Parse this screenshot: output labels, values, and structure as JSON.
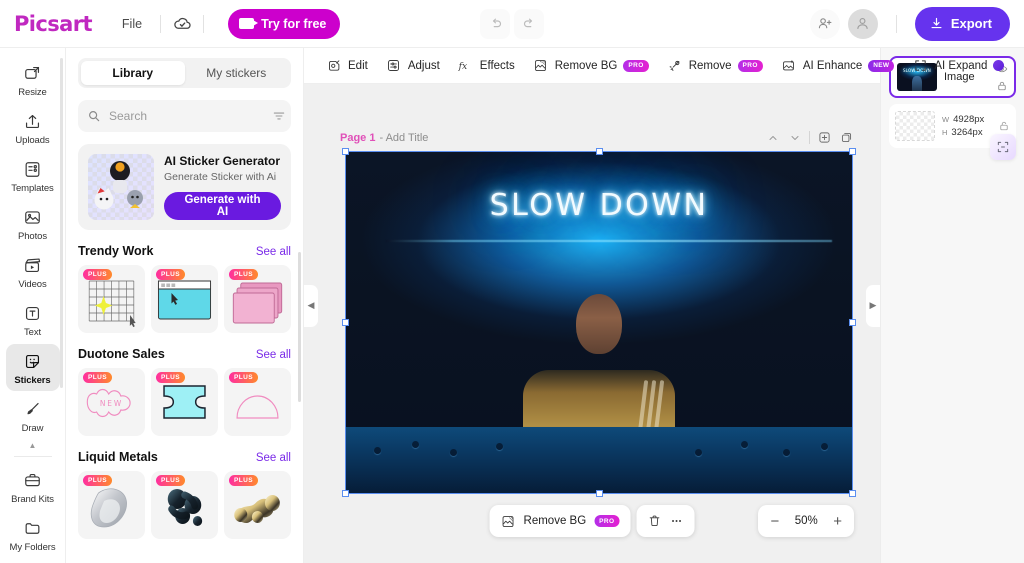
{
  "header": {
    "brand": "Picsart",
    "file_label": "File",
    "cloud_icon": "cloud-check-icon",
    "try_label": "Try for free",
    "undo_icon": "undo-icon",
    "redo_icon": "redo-icon",
    "invite_icon": "add-user-icon",
    "avatar_icon": "user-avatar-icon",
    "export_label": "Export",
    "export_icon": "download-icon",
    "export_color": "#6633ee",
    "try_color": "#cc00cc"
  },
  "rail": {
    "items": [
      {
        "label": "Resize",
        "icon": "resize-icon",
        "active": false
      },
      {
        "label": "Uploads",
        "icon": "upload-icon",
        "active": false
      },
      {
        "label": "Templates",
        "icon": "templates-icon",
        "active": false
      },
      {
        "label": "Photos",
        "icon": "photo-icon",
        "active": false
      },
      {
        "label": "Videos",
        "icon": "video-clapper-icon",
        "active": false
      },
      {
        "label": "Text",
        "icon": "text-icon",
        "active": false
      },
      {
        "label": "Stickers",
        "icon": "sticker-icon",
        "active": true
      },
      {
        "label": "Draw",
        "icon": "brush-icon",
        "active": false
      }
    ],
    "collapse_icon": "chevron-up-icon",
    "bottom_items": [
      {
        "label": "Brand Kits",
        "icon": "briefcase-icon"
      },
      {
        "label": "My Folders",
        "icon": "folder-icon"
      }
    ]
  },
  "panel": {
    "tabs": [
      {
        "label": "Library",
        "active": true
      },
      {
        "label": "My stickers",
        "active": false
      }
    ],
    "search": {
      "placeholder": "Search",
      "value": "",
      "icon": "search-icon",
      "filter_icon": "filter-icon"
    },
    "promo": {
      "title": "AI Sticker Generator",
      "subtitle": "Generate Sticker with Ai",
      "button": "Generate with AI",
      "button_color": "#6a1ae0"
    },
    "sections": [
      {
        "title": "Trendy Work",
        "see_all": "See all",
        "tiles": [
          {
            "badge": "PLUS",
            "art": "grid-sparkle"
          },
          {
            "badge": "PLUS",
            "art": "window-cyan"
          },
          {
            "badge": "PLUS",
            "art": "pink-stack"
          }
        ]
      },
      {
        "title": "Duotone Sales",
        "see_all": "See all",
        "tiles": [
          {
            "badge": "PLUS",
            "art": "new-blob"
          },
          {
            "badge": "PLUS",
            "art": "cyan-spool"
          },
          {
            "badge": "PLUS",
            "art": "pink-arch"
          }
        ]
      },
      {
        "title": "Liquid Metals",
        "see_all": "See all",
        "tiles": [
          {
            "badge": "PLUS",
            "art": "chrome-ring"
          },
          {
            "badge": "PLUS",
            "art": "black-splash"
          },
          {
            "badge": "PLUS",
            "art": "gold-chain"
          }
        ]
      }
    ]
  },
  "toolbar": {
    "items": [
      {
        "label": "Edit",
        "icon": "edit-image-icon",
        "badge": ""
      },
      {
        "label": "Adjust",
        "icon": "adjust-sliders-icon",
        "badge": ""
      },
      {
        "label": "Effects",
        "icon": "fx-icon",
        "badge": ""
      },
      {
        "label": "Remove BG",
        "icon": "remove-bg-icon",
        "badge": "PRO"
      },
      {
        "label": "Remove",
        "icon": "magic-eraser-icon",
        "badge": "PRO"
      },
      {
        "label": "AI Enhance",
        "icon": "ai-enhance-icon",
        "badge": "NEW"
      },
      {
        "label": "AI Expand",
        "icon": "expand-icon",
        "badge": "DOT"
      }
    ]
  },
  "canvas": {
    "page_number": "Page 1",
    "page_title": "- Add Title",
    "page_tools": [
      {
        "icon": "chevron-up-icon"
      },
      {
        "icon": "chevron-down-icon"
      },
      {
        "icon": "add-page-icon"
      },
      {
        "icon": "duplicate-page-icon"
      }
    ],
    "left_arrow": "collapse-left-icon",
    "right_arrow": "collapse-right-icon",
    "image": {
      "neon_text": "SLOW DOWN",
      "alt": "woman seated under blue neon sign"
    },
    "floating": {
      "remove_bg_label": "Remove BG",
      "remove_bg_badge": "PRO",
      "delete_icon": "trash-icon",
      "more_icon": "more-horizontal-icon"
    },
    "zoom": {
      "minus": "−",
      "value": "50%",
      "plus": "+"
    }
  },
  "layers": {
    "items": [
      {
        "name": "Image",
        "selected": true,
        "eye_icon": "eye-icon",
        "lock_icon": "lock-icon"
      }
    ],
    "dimensions": {
      "width_key": "W",
      "width_value": "4928px",
      "height_key": "H",
      "height_value": "3264px",
      "lock_icon": "lock-icon"
    },
    "resize_fab_icon": "resize-arrows-icon"
  }
}
